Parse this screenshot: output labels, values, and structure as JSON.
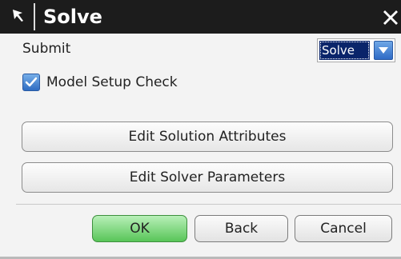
{
  "window": {
    "title": "Solve",
    "title_icon": "pointer-arrow-icon",
    "close_icon": "close-icon"
  },
  "submit": {
    "label": "Submit",
    "selected": "Solve",
    "arrow_icon": "chevron-down-icon"
  },
  "model_check": {
    "label": "Model Setup Check",
    "checked": true
  },
  "buttons": {
    "edit_solution_attributes": "Edit Solution Attributes",
    "edit_solver_parameters": "Edit Solver Parameters"
  },
  "footer": {
    "ok": "OK",
    "back": "Back",
    "cancel": "Cancel"
  },
  "colors": {
    "title_bar": "#1c1c1c",
    "selection": "#0a246a",
    "ok_button": "#58c558",
    "checkbox": "#2e6cc2"
  }
}
